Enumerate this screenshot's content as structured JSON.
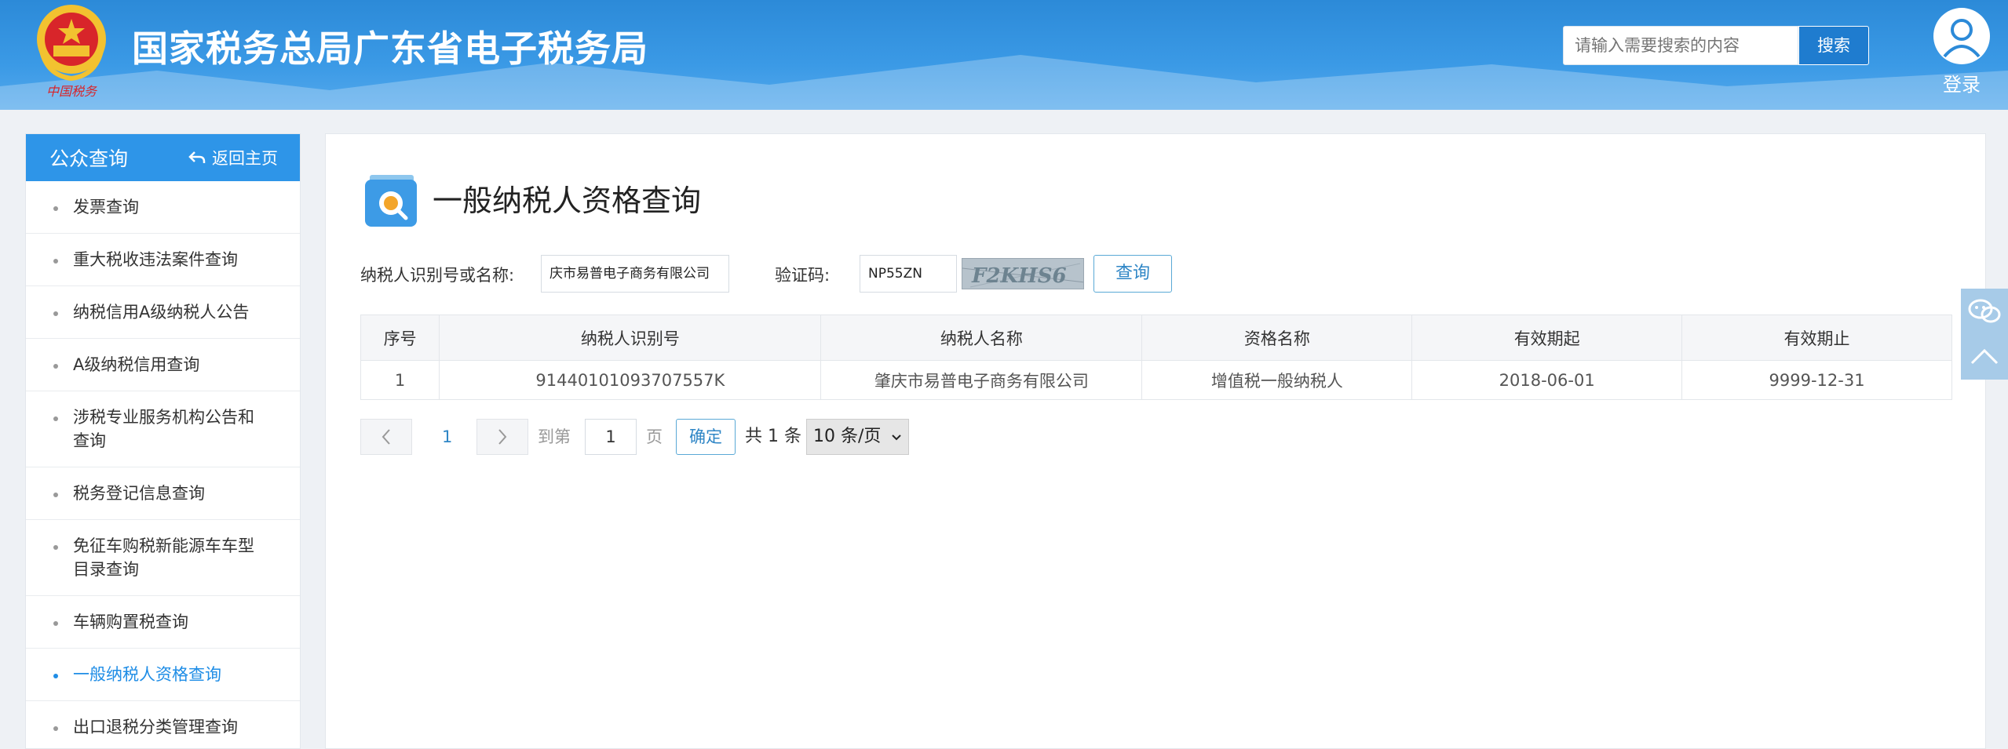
{
  "header": {
    "site_title": "国家税务总局广东省电子税务局",
    "emblem_caption": "中国税务",
    "search_placeholder": "请输入需要搜索的内容",
    "search_button": "搜索",
    "login_label": "登录"
  },
  "sidebar": {
    "title": "公众查询",
    "back_label": "返回主页",
    "items": [
      {
        "label": "发票查询"
      },
      {
        "label": "重大税收违法案件查询"
      },
      {
        "label": "纳税信用A级纳税人公告"
      },
      {
        "label": "A级纳税信用查询"
      },
      {
        "label": "涉税专业服务机构公告和查询"
      },
      {
        "label": "税务登记信息查询"
      },
      {
        "label": "免征车购税新能源车车型目录查询"
      },
      {
        "label": "车辆购置税查询"
      },
      {
        "label": "一般纳税人资格查询",
        "active": true
      },
      {
        "label": "出口退税分类管理查询"
      }
    ]
  },
  "main": {
    "page_title": "一般纳税人资格查询",
    "form": {
      "taxpayer_label": "纳税人识别号或名称:",
      "taxpayer_value": "庆市易普电子商务有限公司",
      "captcha_label": "验证码:",
      "captcha_value": "NP55ZN",
      "captcha_image_text": "F2KHS6",
      "query_button": "查询"
    },
    "table": {
      "headers": [
        "序号",
        "纳税人识别号",
        "纳税人名称",
        "资格名称",
        "有效期起",
        "有效期止"
      ],
      "rows": [
        [
          "1",
          "91440101093707557K",
          "肇庆市易普电子商务有限公司",
          "增值税一般纳税人",
          "2018-06-01",
          "9999-12-31"
        ]
      ]
    },
    "pager": {
      "current_page": "1",
      "goto_label": "到第",
      "goto_value": "1",
      "page_unit": "页",
      "confirm": "确定",
      "total": "共 1 条",
      "page_size": "10 条/页"
    }
  },
  "colors": {
    "header_blue": "#2c8ad8",
    "sidebar_head": "#2e95e8",
    "active_link": "#1f8de6"
  }
}
